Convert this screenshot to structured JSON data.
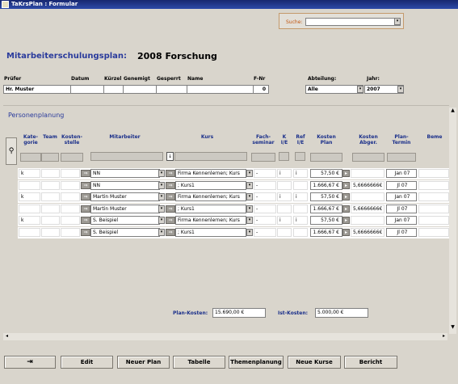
{
  "window": {
    "title": "TaKrsPlan : Formular"
  },
  "search": {
    "label": "Suche:"
  },
  "header": {
    "title": "Mitarbeiterschulungsplan:",
    "subtitle": "2008 Forschung"
  },
  "filter": {
    "columns": [
      "Prüfer",
      "Datum",
      "Kürzel",
      "Genemigt",
      "Gesperrt",
      "Name",
      "F-Nr"
    ],
    "values": [
      "Hr. Muster",
      "",
      "",
      "",
      "",
      "",
      "0"
    ]
  },
  "abteilung": {
    "label": "Abteilung:",
    "value": "Alle"
  },
  "jahr": {
    "label": "Jahr:",
    "value": "2007"
  },
  "section": {
    "title": "Personenplanung"
  },
  "grid": {
    "headers": {
      "kategorie": "Kate-\ngorie",
      "team": "Team",
      "kostenstelle": "Kosten-\nstelle",
      "mitarbeiter": "Mitarbeiter",
      "kurs": "Kurs",
      "fachseminar": "Fach-\nseminar",
      "kie": "K\nI/E",
      "rie": "Ref\nI/E",
      "kostenplan": "Kosten\nPlan",
      "kostenabger": "Kosten\nAbger.",
      "plantermin": "Plan-\nTermin",
      "bem": "Beme"
    },
    "rows": [
      {
        "kat": "k",
        "mitarbeiter": "NN",
        "kurs": "Firma Kennenlernen; Kurs",
        "ki": "i",
        "ri": "i",
        "kosten": "57,50 €",
        "abger": "",
        "termin": "Jan 07"
      },
      {
        "kat": "",
        "mitarbeiter": "NN",
        "kurs": "; Kurs1",
        "ki": "",
        "ri": "",
        "kosten": "1.666,67 €",
        "abger": "5,6666666€",
        "termin": "Jl 07"
      },
      {
        "kat": "k",
        "mitarbeiter": "Martin Muster",
        "kurs": "Firma Kennenlernen; Kurs",
        "ki": "i",
        "ri": "i",
        "kosten": "57,50 €",
        "abger": "",
        "termin": "Jan 07"
      },
      {
        "kat": "",
        "mitarbeiter": "Martin Muster",
        "kurs": "; Kurs1",
        "ki": "",
        "ri": "",
        "kosten": "1.666,67 €",
        "abger": "5,6666666€",
        "termin": "Jl 07"
      },
      {
        "kat": "k",
        "mitarbeiter": "S. Beispiel",
        "kurs": "Firma Kennenlernen; Kurs",
        "ki": "i",
        "ri": "i",
        "kosten": "57,50 €",
        "abger": "",
        "termin": "Jan 07"
      },
      {
        "kat": "",
        "mitarbeiter": "S. Beispiel",
        "kurs": "; Kurs1",
        "ki": "",
        "ri": "",
        "kosten": "1.666,67 €",
        "abger": "5,6666666€",
        "termin": "Jl 07"
      }
    ]
  },
  "totals": {
    "plan_label": "Plan-Kosten:",
    "plan_value": "15.690,00 €",
    "ist_label": "Ist-Kosten:",
    "ist_value": "5.000,00 €"
  },
  "buttons": {
    "edit": "Edit",
    "neuer_plan": "Neuer Plan",
    "tabelle": "Tabelle",
    "themenplanung": "Themenplanung",
    "neue_kurse": "Neue Kurse",
    "bericht": "Bericht"
  }
}
